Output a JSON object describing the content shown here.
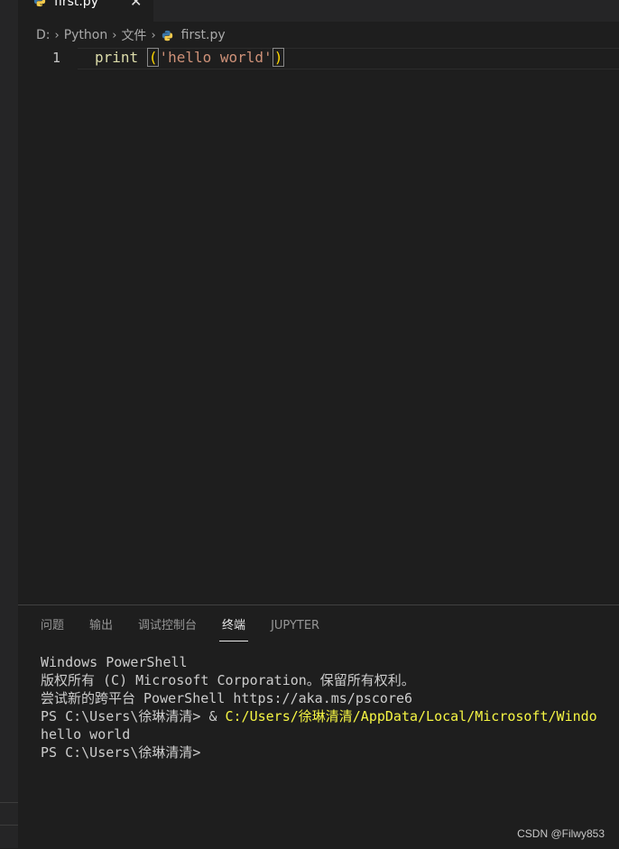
{
  "tab": {
    "label": "first.py",
    "close": "✕"
  },
  "breadcrumb": {
    "items": [
      "D:",
      "Python",
      "文件",
      "first.py"
    ]
  },
  "editor": {
    "line_number": "1",
    "code": {
      "fn": "print",
      "space": " ",
      "open": "(",
      "str": "'hello world'",
      "close": ")"
    }
  },
  "panel": {
    "tabs": [
      "问题",
      "输出",
      "调试控制台",
      "终端",
      "JUPYTER"
    ],
    "active_tab": "终端"
  },
  "terminal": {
    "lines": [
      "Windows PowerShell",
      "版权所有 (C) Microsoft Corporation。保留所有权利。",
      "",
      "尝试新的跨平台 PowerShell https://aka.ms/pscore6",
      ""
    ],
    "prompt": "PS C:\\Users\\徐琳清清> ",
    "command_amp": "& ",
    "command_path": "C:/Users/徐琳清清/AppData/Local/Microsoft/Windo",
    "output": "hello world",
    "final_prompt": "PS C:\\Users\\徐琳清清>"
  },
  "watermark": "CSDN @Filwy853",
  "colors": {
    "bg": "#1e1e1e",
    "fn": "#dcdcaa",
    "str": "#ce9178",
    "paren": "#ffd700",
    "term_path": "#f5f543"
  },
  "icons": {
    "file": "python-icon"
  }
}
